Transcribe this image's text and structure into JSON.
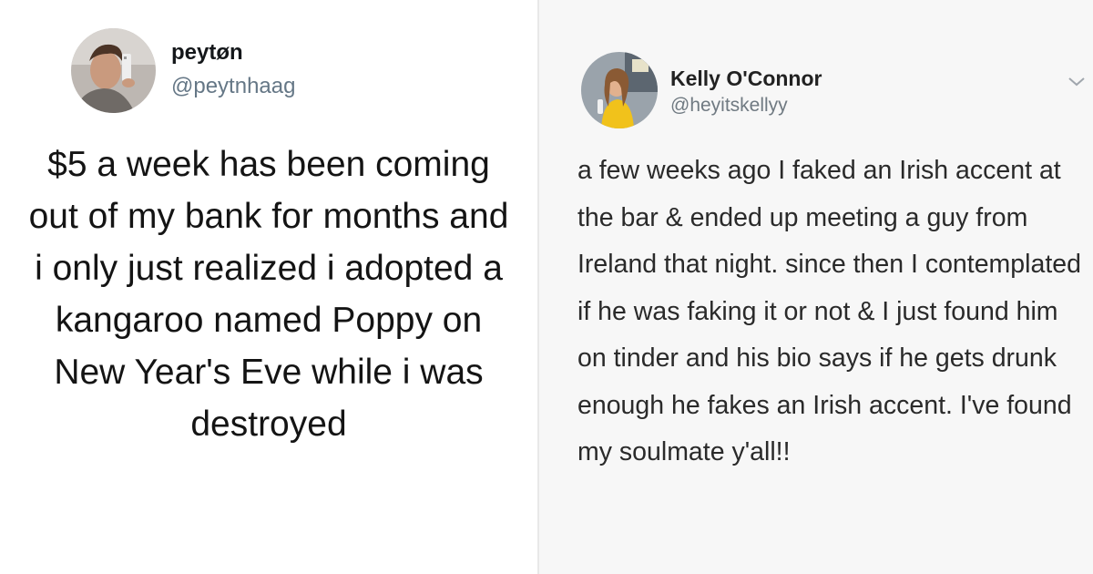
{
  "left_tweet": {
    "display_name": "peytøn",
    "handle": "@peytnhaag",
    "text": "$5 a week has been coming out of my bank for months and i only just realized i adopted a kangaroo named Poppy on New Year's Eve while i was destroyed"
  },
  "right_tweet": {
    "display_name": "Kelly O'Connor",
    "handle": "@heyitskellyy",
    "text": "a few weeks ago I faked an Irish accent at the bar & ended up meeting a guy from Ireland that night. since then I contemplated if he was faking it or not & I just found him on tinder and his bio says if he gets drunk enough he fakes an Irish accent. I've found my soulmate y'all!!",
    "menu_icon": "chevron-down-icon"
  },
  "colors": {
    "name": "#14171a",
    "handle": "#657786",
    "right_background": "#f7f7f7"
  }
}
